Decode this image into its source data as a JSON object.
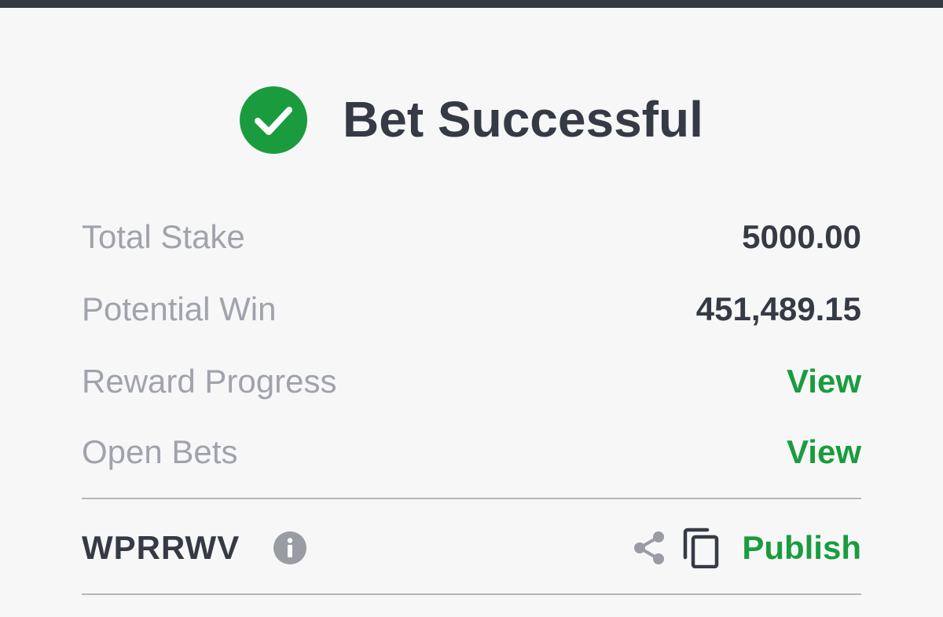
{
  "header": {
    "title": "Bet Successful",
    "icon": "check-circle-icon",
    "icon_color": "#1a9c3e"
  },
  "summary": {
    "total_stake": {
      "label": "Total Stake",
      "value": "5000.00"
    },
    "potential_win": {
      "label": "Potential Win",
      "value": "451,489.15"
    },
    "reward_progress": {
      "label": "Reward Progress",
      "action": "View"
    },
    "open_bets": {
      "label": "Open Bets",
      "action": "View"
    }
  },
  "booking": {
    "code": "WPRRWV",
    "info_icon": "info-icon",
    "share_icon": "share-icon",
    "copy_icon": "copy-icon",
    "publish_label": "Publish"
  },
  "colors": {
    "accent_green": "#1a9c3e",
    "text_dark": "#353a45",
    "text_muted": "#a0a3ab",
    "background": "#f7f7f8"
  }
}
